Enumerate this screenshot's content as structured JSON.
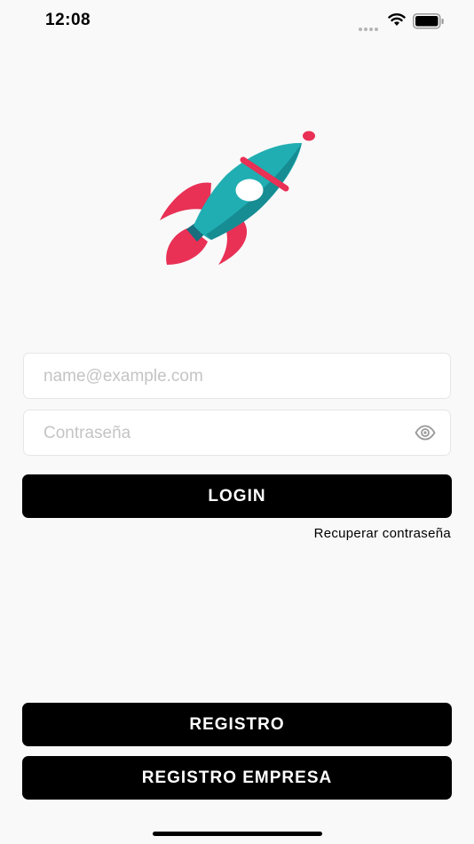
{
  "status_bar": {
    "time": "12:08"
  },
  "login_form": {
    "email_placeholder": "name@example.com",
    "password_placeholder": "Contraseña",
    "login_label": "LOGIN",
    "forgot_password_label": "Recuperar contraseña"
  },
  "footer": {
    "register_label": "REGISTRO",
    "register_company_label": "REGISTRO EMPRESA"
  },
  "icons": {
    "status": [
      "cellular-signal-icon",
      "wifi-icon",
      "battery-icon"
    ],
    "logo": "rocket-logo",
    "password_toggle": "eye-icon"
  },
  "colors": {
    "primary_button": "#000000",
    "rocket_teal": "#20aeb2",
    "rocket_red": "#e93055"
  }
}
